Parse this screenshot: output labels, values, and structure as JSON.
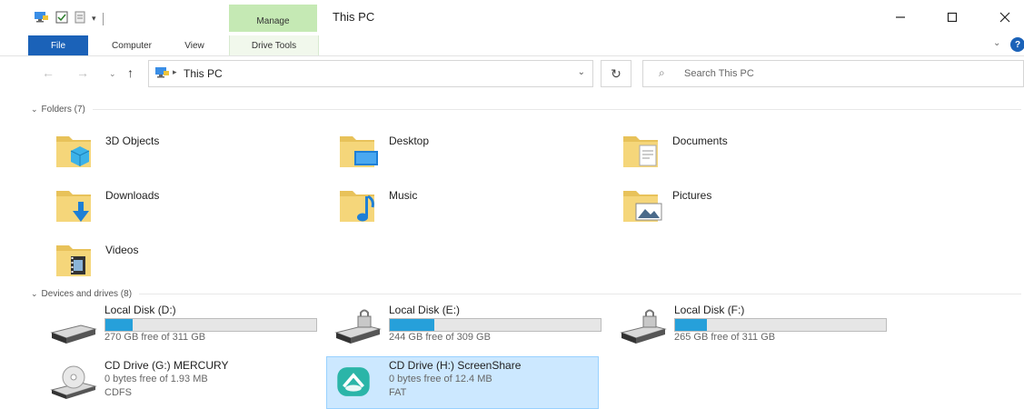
{
  "window": {
    "title": "This PC",
    "context_tab": "Manage"
  },
  "ribbon": {
    "tabs": {
      "file": "File",
      "computer": "Computer",
      "view": "View",
      "drive_tools": "Drive Tools"
    }
  },
  "nav": {
    "address": {
      "path_label": "This PC"
    },
    "search": {
      "placeholder": "Search This PC"
    }
  },
  "folders_section": {
    "header": "Folders (7)",
    "items": [
      {
        "name": "3D Objects",
        "icon": "3d-objects-folder-icon"
      },
      {
        "name": "Desktop",
        "icon": "desktop-folder-icon"
      },
      {
        "name": "Documents",
        "icon": "documents-folder-icon"
      },
      {
        "name": "Downloads",
        "icon": "downloads-folder-icon"
      },
      {
        "name": "Music",
        "icon": "music-folder-icon"
      },
      {
        "name": "Pictures",
        "icon": "pictures-folder-icon"
      },
      {
        "name": "Videos",
        "icon": "videos-folder-icon"
      }
    ]
  },
  "drives_section": {
    "header": "Devices and drives (8)",
    "items": [
      {
        "name": "Local Disk (D:)",
        "free": "270 GB free of 311 GB",
        "used_fraction": 0.13,
        "icon": "hard-drive-icon"
      },
      {
        "name": "Local Disk (E:)",
        "free": "244 GB free of 309 GB",
        "used_fraction": 0.21,
        "icon": "locked-drive-icon"
      },
      {
        "name": "Local Disk (F:)",
        "free": "265 GB free of 311 GB",
        "used_fraction": 0.15,
        "icon": "locked-drive-icon"
      },
      {
        "name": "CD Drive (G:) MERCURY",
        "free": "0 bytes free of 1.93 MB",
        "fs": "CDFS",
        "icon": "cd-drive-icon"
      },
      {
        "name": "CD Drive (H:) ScreenShare",
        "free": "0 bytes free of 12.4 MB",
        "fs": "FAT",
        "icon": "screenshare-drive-icon",
        "selected": true
      }
    ]
  },
  "colors": {
    "accent": "#1b62b8",
    "context_tab": "#c5e9b4",
    "usage_bar": "#26a0da",
    "selection": "#cce8ff"
  }
}
